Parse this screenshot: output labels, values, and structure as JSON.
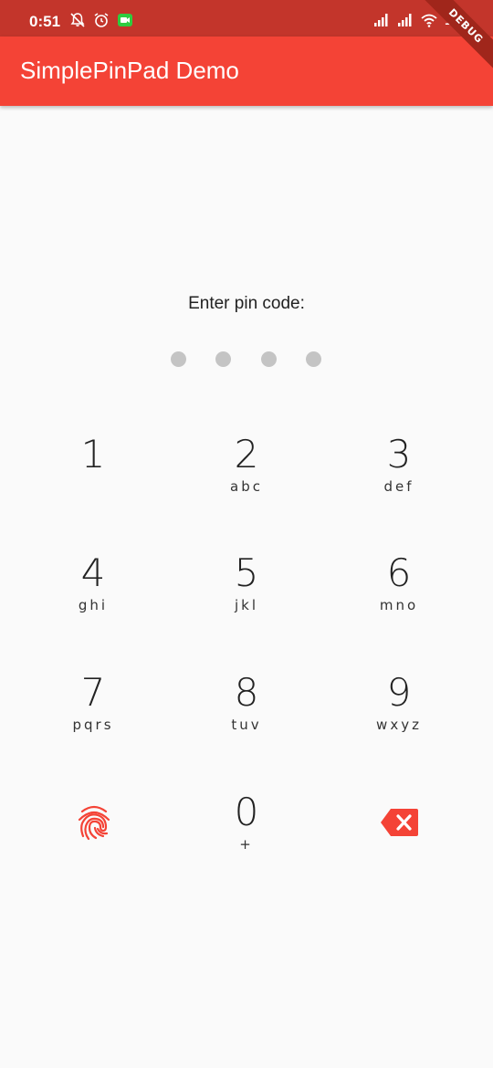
{
  "status_bar": {
    "time": "0:51",
    "battery": "100",
    "icons_left": [
      "muted-bell-icon",
      "alarm-icon",
      "video-call-icon"
    ],
    "icons_right": [
      "signal-icon",
      "signal-icon",
      "wifi-icon"
    ]
  },
  "debug_banner": "DEBUG",
  "app_bar": {
    "title": "SimplePinPad Demo"
  },
  "pin": {
    "prompt": "Enter pin code:",
    "dot_count": 4,
    "dot_color": "#c4c4c4"
  },
  "keypad": {
    "keys": [
      {
        "digit": "1",
        "letters": ""
      },
      {
        "digit": "2",
        "letters": "abc"
      },
      {
        "digit": "3",
        "letters": "def"
      },
      {
        "digit": "4",
        "letters": "ghi"
      },
      {
        "digit": "5",
        "letters": "jkl"
      },
      {
        "digit": "6",
        "letters": "mno"
      },
      {
        "digit": "7",
        "letters": "pqrs"
      },
      {
        "digit": "8",
        "letters": "tuv"
      },
      {
        "digit": "9",
        "letters": "wxyz"
      },
      {
        "digit": "0",
        "letters": "+"
      }
    ],
    "fingerprint_icon": "fingerprint-icon",
    "backspace_icon": "backspace-icon",
    "accent_color": "#f44336"
  },
  "colors": {
    "app_bar": "#f44336",
    "status_bar": "#c3352b",
    "background": "#fafafa"
  }
}
